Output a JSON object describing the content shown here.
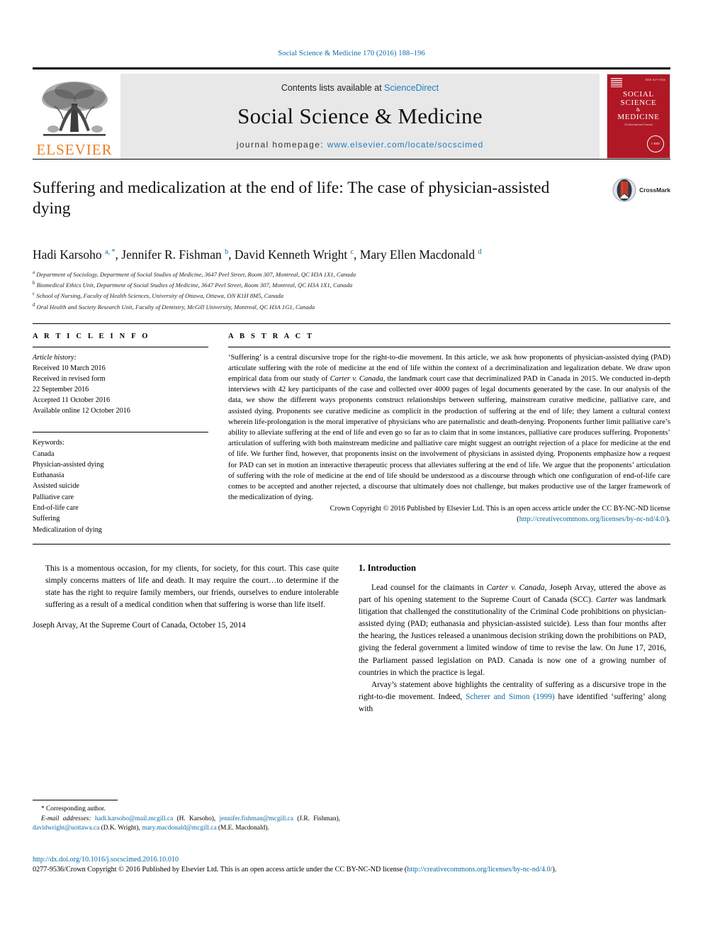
{
  "running_head": "Social Science & Medicine 170 (2016) 188–196",
  "masthead": {
    "publisher_logo_label": "ELSEVIER",
    "contents_prefix": "Contents lists available at ",
    "contents_link": "ScienceDirect",
    "journal_title": "Social Science & Medicine",
    "homepage_prefix": "journal homepage: ",
    "homepage_url": "www.elsevier.com/locate/socscimed",
    "cover": {
      "title_line1": "SOCIAL",
      "title_line2": "SCIENCE",
      "amp": "&",
      "title_line3": "MEDICINE",
      "subtitle": "An International Journal",
      "issn_note": "ISSN 0277-9536",
      "seal_text": "C  RED"
    }
  },
  "article": {
    "title": "Suffering and medicalization at the end of life: The case of physician-assisted dying",
    "crossmark_label": "CrossMark",
    "authors_html": "Hadi Karsoho <sup>a, *</sup>, Jennifer R. Fishman <sup>b</sup>, David Kenneth Wright <sup>c</sup>, Mary Ellen Macdonald <sup>d</sup>",
    "affiliations": [
      {
        "marker": "a",
        "text": "Department of Sociology, Department of Social Studies of Medicine, 3647 Peel Street, Room 307, Montreal, QC H3A 1X1, Canada"
      },
      {
        "marker": "b",
        "text": "Biomedical Ethics Unit, Department of Social Studies of Medicine, 3647 Peel Street, Room 307, Montreal, QC H3A 1X1, Canada"
      },
      {
        "marker": "c",
        "text": "School of Nursing, Faculty of Health Sciences, University of Ottawa, Ottawa, ON K1H 8M5, Canada"
      },
      {
        "marker": "d",
        "text": "Oral Health and Society Research Unit, Faculty of Dentistry, McGill University, Montreal, QC H3A 1G1, Canada"
      }
    ]
  },
  "article_info": {
    "heading": "A R T I C L E  I N F O",
    "history_label": "Article history:",
    "history": [
      "Received 10 March 2016",
      "Received in revised form",
      "22 September 2016",
      "Accepted 11 October 2016",
      "Available online 12 October 2016"
    ],
    "keywords_label": "Keywords:",
    "keywords": [
      "Canada",
      "Physician-assisted dying",
      "Euthanasia",
      "Assisted suicide",
      "Palliative care",
      "End-of-life care",
      "Suffering",
      "Medicalization of dying"
    ]
  },
  "abstract": {
    "heading": "A B S T R A C T",
    "text_html": "&lsquo;Suffering&rsquo; is a central discursive trope for the right-to-die movement. In this article, we ask how proponents of physician-assisted dying (PAD) articulate suffering with the role of medicine at the end of life within the context of a decriminalization and legalization debate. We draw upon empirical data from our study of <span class=\"ital\">Carter v. Canada</span>, the landmark court case that decriminalized PAD in Canada in 2015. We conducted in-depth interviews with 42 key participants of the case and collected over 4000 pages of legal documents generated by the case. In our analysis of the data, we show the different ways proponents construct relationships between suffering, mainstream curative medicine, palliative care, and assisted dying. Proponents see curative medicine as complicit in the production of suffering at the end of life; they lament a cultural context wherein life-prolongation is the moral imperative of physicians who are paternalistic and death-denying. Proponents further limit palliative care&rsquo;s ability to alleviate suffering at the end of life and even go so far as to claim that in some instances, palliative care produces suffering. Proponents&rsquo; articulation of suffering with both mainstream medicine and palliative care might suggest an outright rejection of a place for medicine at the end of life. We further find, however, that proponents insist on the involvement of physicians in assisted dying. Proponents emphasize how a request for PAD can set in motion an interactive therapeutic process that alleviates suffering at the end of life. We argue that the proponents&rsquo; articulation of suffering with the role of medicine at the end of life should be understood as a discourse through which one configuration of end-of-life care comes to be accepted and another rejected, a discourse that ultimately does not challenge, but makes productive use of the larger framework of the medicalization of dying.",
    "copyright_html": "Crown Copyright &copy; 2016 Published by Elsevier Ltd. This is an open access article under the CC BY-NC-ND license (<span class=\"link\">http://creativecommons.org/licenses/by-nc-nd/4.0/</span>)."
  },
  "epigraph": {
    "quote": "This is a momentous occasion, for my clients, for society, for this court. This case quite simply concerns matters of life and death. It may require the court…to determine if the state has the right to require family members, our friends, ourselves to endure intolerable suffering as a result of a medical condition when that suffering is worse than life itself.",
    "attribution": "Joseph Arvay, At the Supreme Court of Canada, October 15, 2014"
  },
  "introduction": {
    "heading": "1. Introduction",
    "paragraph1_html": "Lead counsel for the claimants in <span class=\"ital\">Carter v. Canada</span>, Joseph Arvay, uttered the above as part of his opening statement to the Supreme Court of Canada (SCC). <span class=\"ital\">Carter</span> was landmark litigation that challenged the constitutionality of the Criminal Code prohibitions on physician-assisted dying (PAD; euthanasia and physician-assisted suicide). Less than four months after the hearing, the Justices released a unanimous decision striking down the prohibitions on PAD, giving the federal government a limited window of time to revise the law. On June 17, 2016, the Parliament passed legislation on PAD. Canada is now one of a growing number of countries in which the practice is legal.",
    "paragraph2_html": "Arvay&rsquo;s statement above highlights the centrality of suffering as a discursive trope in the right-to-die movement. Indeed, <span class=\"link\">Scherer and Simon (1999)</span> have identified &lsquo;suffering&rsquo; along with"
  },
  "footnotes": {
    "corresponding_author": "* Corresponding author.",
    "email_label": "E-mail addresses:",
    "emails_html": "<span class=\"link\">hadi.karsoho@mail.mcgill.ca</span> (H. Karsoho), <span class=\"link\">jennifer.fishman@mcgill.ca</span> (J.R. Fishman), <span class=\"link\">davidwright@uottawa.ca</span> (D.K. Wright), <span class=\"link\">mary.macdonald@mcgill.ca</span> (M.E. Macdonald)."
  },
  "page_footer": {
    "doi": "http://dx.doi.org/10.1016/j.socscimed.2016.10.010",
    "issn_html": "0277-9536/Crown Copyright &copy; 2016 Published by Elsevier Ltd. This is an open access article under the CC BY-NC-ND license (<span class=\"link\">http://creativecommons.org/licenses/by-nc-nd/4.0/</span>)."
  },
  "colors": {
    "link": "#0b6aa2",
    "elsevier_orange": "#ec7d24",
    "cover_red": "#b01825",
    "masthead_gray": "#e8e8e8"
  }
}
